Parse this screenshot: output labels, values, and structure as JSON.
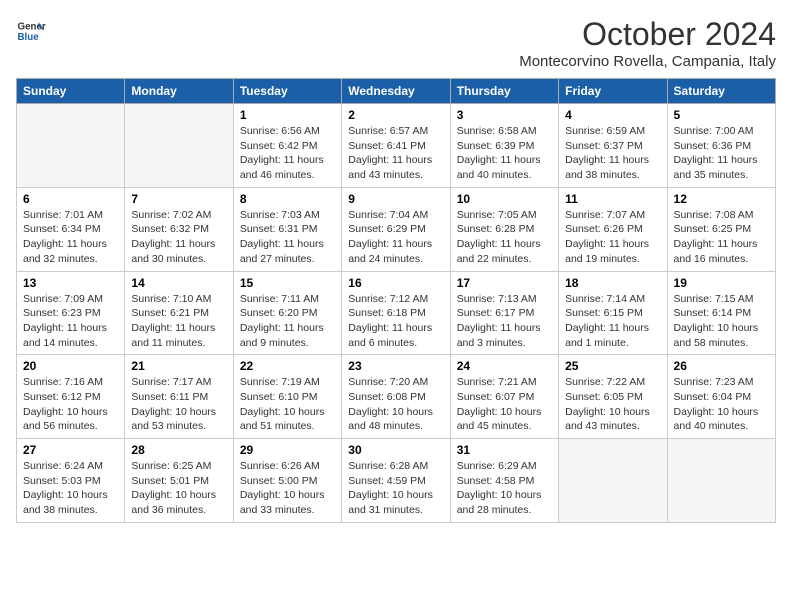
{
  "logo": {
    "line1": "General",
    "line2": "Blue"
  },
  "title": "October 2024",
  "location": "Montecorvino Rovella, Campania, Italy",
  "days_of_week": [
    "Sunday",
    "Monday",
    "Tuesday",
    "Wednesday",
    "Thursday",
    "Friday",
    "Saturday"
  ],
  "weeks": [
    [
      {
        "num": "",
        "info": ""
      },
      {
        "num": "",
        "info": ""
      },
      {
        "num": "1",
        "info": "Sunrise: 6:56 AM\nSunset: 6:42 PM\nDaylight: 11 hours and 46 minutes."
      },
      {
        "num": "2",
        "info": "Sunrise: 6:57 AM\nSunset: 6:41 PM\nDaylight: 11 hours and 43 minutes."
      },
      {
        "num": "3",
        "info": "Sunrise: 6:58 AM\nSunset: 6:39 PM\nDaylight: 11 hours and 40 minutes."
      },
      {
        "num": "4",
        "info": "Sunrise: 6:59 AM\nSunset: 6:37 PM\nDaylight: 11 hours and 38 minutes."
      },
      {
        "num": "5",
        "info": "Sunrise: 7:00 AM\nSunset: 6:36 PM\nDaylight: 11 hours and 35 minutes."
      }
    ],
    [
      {
        "num": "6",
        "info": "Sunrise: 7:01 AM\nSunset: 6:34 PM\nDaylight: 11 hours and 32 minutes."
      },
      {
        "num": "7",
        "info": "Sunrise: 7:02 AM\nSunset: 6:32 PM\nDaylight: 11 hours and 30 minutes."
      },
      {
        "num": "8",
        "info": "Sunrise: 7:03 AM\nSunset: 6:31 PM\nDaylight: 11 hours and 27 minutes."
      },
      {
        "num": "9",
        "info": "Sunrise: 7:04 AM\nSunset: 6:29 PM\nDaylight: 11 hours and 24 minutes."
      },
      {
        "num": "10",
        "info": "Sunrise: 7:05 AM\nSunset: 6:28 PM\nDaylight: 11 hours and 22 minutes."
      },
      {
        "num": "11",
        "info": "Sunrise: 7:07 AM\nSunset: 6:26 PM\nDaylight: 11 hours and 19 minutes."
      },
      {
        "num": "12",
        "info": "Sunrise: 7:08 AM\nSunset: 6:25 PM\nDaylight: 11 hours and 16 minutes."
      }
    ],
    [
      {
        "num": "13",
        "info": "Sunrise: 7:09 AM\nSunset: 6:23 PM\nDaylight: 11 hours and 14 minutes."
      },
      {
        "num": "14",
        "info": "Sunrise: 7:10 AM\nSunset: 6:21 PM\nDaylight: 11 hours and 11 minutes."
      },
      {
        "num": "15",
        "info": "Sunrise: 7:11 AM\nSunset: 6:20 PM\nDaylight: 11 hours and 9 minutes."
      },
      {
        "num": "16",
        "info": "Sunrise: 7:12 AM\nSunset: 6:18 PM\nDaylight: 11 hours and 6 minutes."
      },
      {
        "num": "17",
        "info": "Sunrise: 7:13 AM\nSunset: 6:17 PM\nDaylight: 11 hours and 3 minutes."
      },
      {
        "num": "18",
        "info": "Sunrise: 7:14 AM\nSunset: 6:15 PM\nDaylight: 11 hours and 1 minute."
      },
      {
        "num": "19",
        "info": "Sunrise: 7:15 AM\nSunset: 6:14 PM\nDaylight: 10 hours and 58 minutes."
      }
    ],
    [
      {
        "num": "20",
        "info": "Sunrise: 7:16 AM\nSunset: 6:12 PM\nDaylight: 10 hours and 56 minutes."
      },
      {
        "num": "21",
        "info": "Sunrise: 7:17 AM\nSunset: 6:11 PM\nDaylight: 10 hours and 53 minutes."
      },
      {
        "num": "22",
        "info": "Sunrise: 7:19 AM\nSunset: 6:10 PM\nDaylight: 10 hours and 51 minutes."
      },
      {
        "num": "23",
        "info": "Sunrise: 7:20 AM\nSunset: 6:08 PM\nDaylight: 10 hours and 48 minutes."
      },
      {
        "num": "24",
        "info": "Sunrise: 7:21 AM\nSunset: 6:07 PM\nDaylight: 10 hours and 45 minutes."
      },
      {
        "num": "25",
        "info": "Sunrise: 7:22 AM\nSunset: 6:05 PM\nDaylight: 10 hours and 43 minutes."
      },
      {
        "num": "26",
        "info": "Sunrise: 7:23 AM\nSunset: 6:04 PM\nDaylight: 10 hours and 40 minutes."
      }
    ],
    [
      {
        "num": "27",
        "info": "Sunrise: 6:24 AM\nSunset: 5:03 PM\nDaylight: 10 hours and 38 minutes."
      },
      {
        "num": "28",
        "info": "Sunrise: 6:25 AM\nSunset: 5:01 PM\nDaylight: 10 hours and 36 minutes."
      },
      {
        "num": "29",
        "info": "Sunrise: 6:26 AM\nSunset: 5:00 PM\nDaylight: 10 hours and 33 minutes."
      },
      {
        "num": "30",
        "info": "Sunrise: 6:28 AM\nSunset: 4:59 PM\nDaylight: 10 hours and 31 minutes."
      },
      {
        "num": "31",
        "info": "Sunrise: 6:29 AM\nSunset: 4:58 PM\nDaylight: 10 hours and 28 minutes."
      },
      {
        "num": "",
        "info": ""
      },
      {
        "num": "",
        "info": ""
      }
    ]
  ]
}
